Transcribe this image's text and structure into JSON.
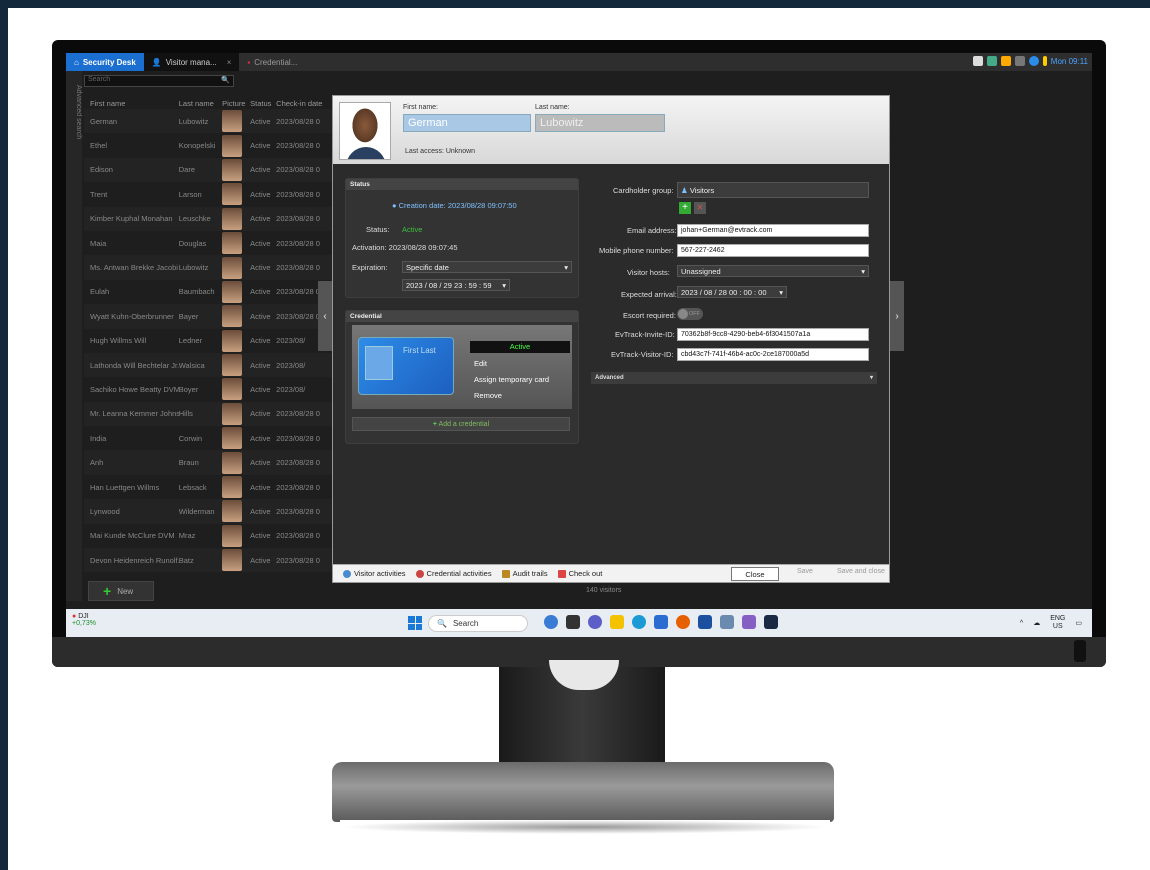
{
  "tabs": [
    {
      "label": "Security Desk"
    },
    {
      "label": "Visitor mana..."
    },
    {
      "label": "Credential..."
    }
  ],
  "tray_top": {
    "clock": "Mon 09:11"
  },
  "sidebar": {
    "label": "Advanced search"
  },
  "search": {
    "placeholder": "Search"
  },
  "list": {
    "headers": [
      "First name",
      "Last name",
      "Picture",
      "Status",
      "Check-in date"
    ],
    "rows": [
      {
        "first": "German",
        "last": "Lubowitz",
        "status": "Active",
        "date": "2023/08/28 0"
      },
      {
        "first": "Ethel",
        "last": "Konopelski",
        "status": "Active",
        "date": "2023/08/28 0"
      },
      {
        "first": "Edison",
        "last": "Dare",
        "status": "Active",
        "date": "2023/08/28 0"
      },
      {
        "first": "Trent",
        "last": "Larson",
        "status": "Active",
        "date": "2023/08/28 0"
      },
      {
        "first": "Kimber Kuphal Monahan",
        "last": "Leuschke",
        "status": "Active",
        "date": "2023/08/28 0"
      },
      {
        "first": "Maia",
        "last": "Douglas",
        "status": "Active",
        "date": "2023/08/28 0"
      },
      {
        "first": "Ms. Antwan Brekke Jacobi",
        "last": "Lubowitz",
        "status": "Active",
        "date": "2023/08/28 0"
      },
      {
        "first": "Eulah",
        "last": "Baumbach",
        "status": "Active",
        "date": "2023/08/28 0"
      },
      {
        "first": "Wyatt Kuhn-Oberbrunner",
        "last": "Bayer",
        "status": "Active",
        "date": "2023/08/28 0"
      },
      {
        "first": "Hugh Willms Will",
        "last": "Ledner",
        "status": "Active",
        "date": "2023/08/"
      },
      {
        "first": "Lathonda Will Bechtelar Jr.",
        "last": "Walsica",
        "status": "Active",
        "date": "2023/08/"
      },
      {
        "first": "Sachiko Howe Beatty DVM",
        "last": "Boyer",
        "status": "Active",
        "date": "2023/08/"
      },
      {
        "first": "Mr. Leanna Kemmer Johns",
        "last": "Hills",
        "status": "Active",
        "date": "2023/08/28 0"
      },
      {
        "first": "India",
        "last": "Corwin",
        "status": "Active",
        "date": "2023/08/28 0"
      },
      {
        "first": "Anh",
        "last": "Braun",
        "status": "Active",
        "date": "2023/08/28 0"
      },
      {
        "first": "Han Luettgen Willms",
        "last": "Lebsack",
        "status": "Active",
        "date": "2023/08/28 0"
      },
      {
        "first": "Lynwood",
        "last": "Wilderman",
        "status": "Active",
        "date": "2023/08/28 0"
      },
      {
        "first": "Mai Kunde McClure DVM",
        "last": "Mraz",
        "status": "Active",
        "date": "2023/08/28 0"
      },
      {
        "first": "Devon Heidenreich Runolf...",
        "last": "Batz",
        "status": "Active",
        "date": "2023/08/28 0"
      }
    ]
  },
  "new_button": "New",
  "visitor_count": "140 visitors",
  "dialog": {
    "first_name_label": "First name:",
    "first_name": "German",
    "last_name_label": "Last name:",
    "last_name": "Lubowitz",
    "last_access": "Last access: Unknown",
    "status_panel": {
      "title": "Status",
      "creation": "Creation date: 2023/08/28 09:07:50",
      "status_label": "Status:",
      "status_value": "Active",
      "activation": "Activation: 2023/08/28 09:07:45",
      "expiration_label": "Expiration:",
      "expiration_value": "Specific date",
      "expiration_date": "2023 / 08 / 29   23 : 59 : 59"
    },
    "credential_panel": {
      "title": "Credential",
      "card_name": "First Last",
      "card_status": "Active",
      "menu": [
        "Edit",
        "Assign temporary card",
        "Remove"
      ],
      "add": "Add a credential"
    },
    "right": {
      "cardholder_group_label": "Cardholder group:",
      "cardholder_group": "Visitors",
      "email_label": "Email address:",
      "email": "johan+German@evtrack.com",
      "phone_label": "Mobile phone number:",
      "phone": "567-227-2462",
      "hosts_label": "Visitor hosts:",
      "hosts": "Unassigned",
      "arrival_label": "Expected arrival:",
      "arrival": "2023 / 08 / 28   00 : 00 : 00",
      "escort_label": "Escort required:",
      "escort": "OFF",
      "invite_label": "EvTrack-Invite-ID:",
      "invite": "70362b8f-9cc8-4290-beb4-6f3041507a1a",
      "visitor_id_label": "EvTrack-Visitor-ID:",
      "visitor_id": "cbd43c7f-741f-46b4-ac0c-2ce187000a5d",
      "advanced": "Advanced"
    },
    "footer": {
      "visitor_activities": "Visitor activities",
      "credential_activities": "Credential activities",
      "audit_trails": "Audit trails",
      "check_out": "Check out",
      "close": "Close",
      "save": "Save",
      "save_close": "Save and close"
    }
  },
  "taskbar": {
    "weather_name": "DJI",
    "weather_change": "+0,73%",
    "search": "Search",
    "lang": "ENG",
    "region": "US"
  }
}
